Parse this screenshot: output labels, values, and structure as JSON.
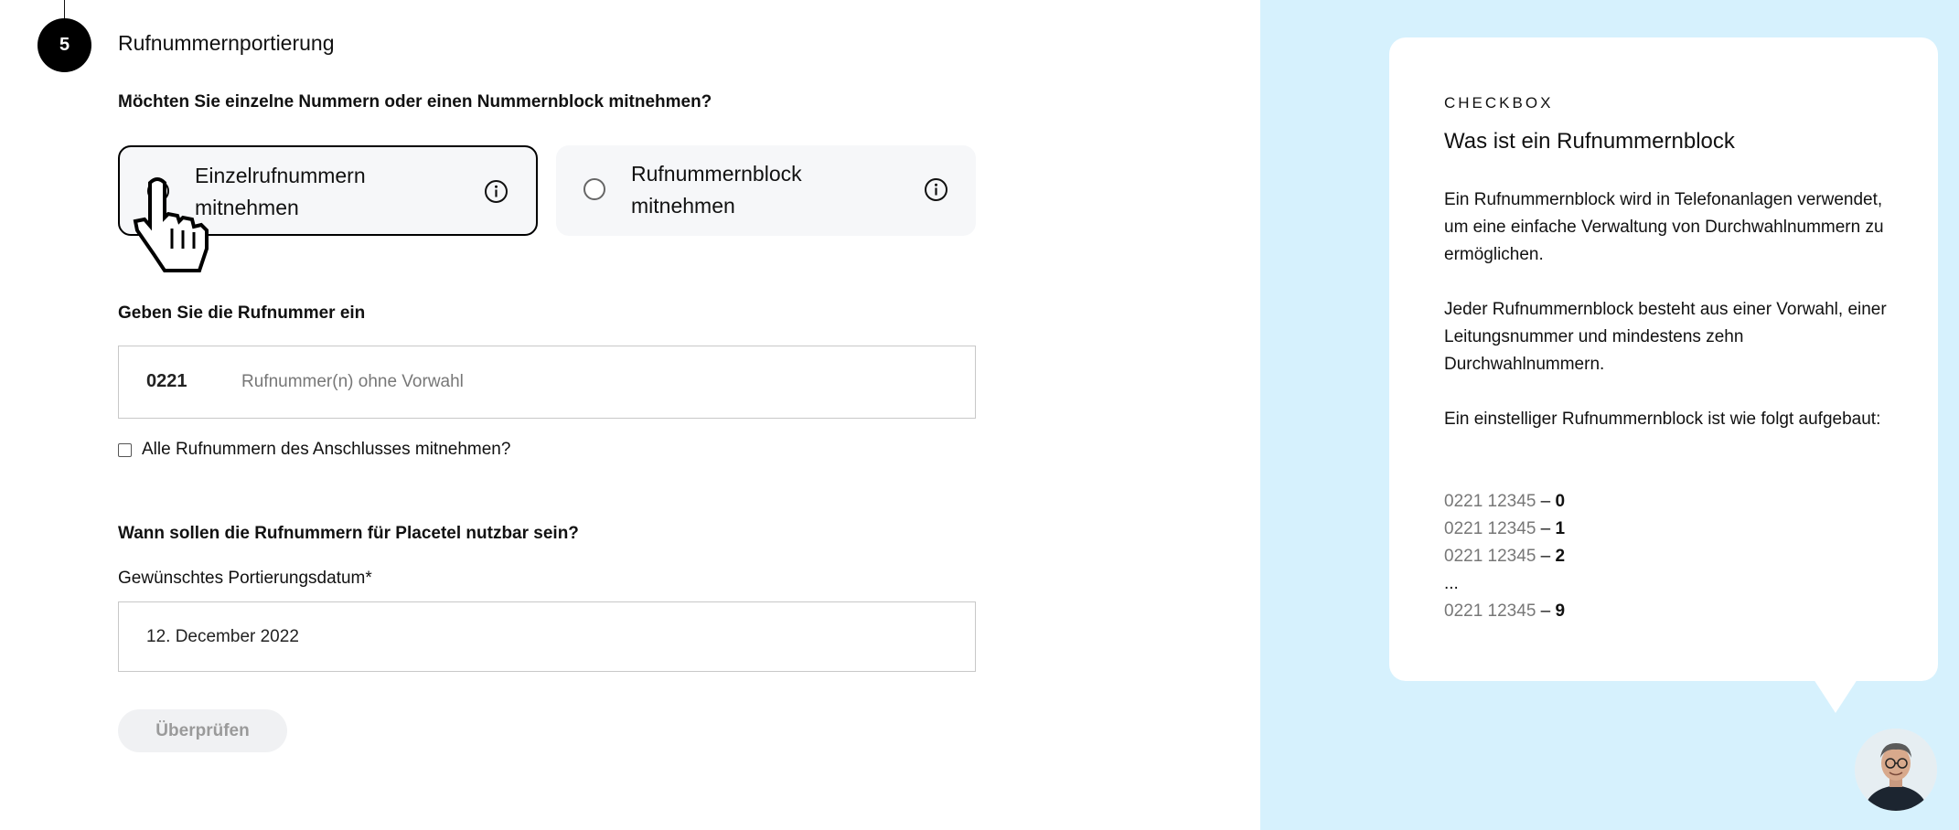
{
  "step": {
    "number": "5",
    "title": "Rufnummernportierung"
  },
  "question_numbers": "Möchten Sie einzelne Nummern oder einen Nummernblock mitnehmen?",
  "options": [
    {
      "label": "Einzelrufnummern mitnehmen",
      "selected": true,
      "info_icon": "info-icon"
    },
    {
      "label": "Rufnummernblock mitnehmen",
      "selected": false,
      "info_icon": "info-icon"
    }
  ],
  "phone": {
    "heading": "Geben Sie die Rufnummer ein",
    "prefix": "0221",
    "placeholder": "Rufnummer(n) ohne Vorwahl",
    "value": ""
  },
  "checkbox": {
    "label": "Alle Rufnummern des Anschlusses mitnehmen?",
    "checked": false
  },
  "date": {
    "heading": "Wann sollen die Rufnummern für Placetel nutzbar sein?",
    "label": "Gewünschtes Portierungsdatum",
    "required_mark": "*",
    "value": "12. December 2022"
  },
  "submit_button": "Überprüfen",
  "help": {
    "eyebrow": "CHECKBOX",
    "title": "Was ist ein Rufnummernblock",
    "p1": "Ein Rufnummernblock wird in Telefonanlagen verwendet, um eine einfache Verwaltung von Durchwahlnummern zu ermöglichen.",
    "p2": "Jeder Rufnummernblock besteht aus einer Vorwahl, einer Leitungsnummer und mindestens zehn Durchwahlnummern.",
    "p3": "Ein einstelliger Rufnummernblock ist wie folgt aufgebaut:",
    "examples": [
      {
        "base": "0221 12345",
        "dash": " – ",
        "ext": "0"
      },
      {
        "base": "0221 12345",
        "dash": " – ",
        "ext": "1"
      },
      {
        "base": "0221 12345",
        "dash": " – ",
        "ext": "2"
      },
      {
        "ellipsis": "..."
      },
      {
        "base": "0221 12345",
        "dash": " – ",
        "ext": "9"
      }
    ]
  },
  "colors": {
    "panel_bg": "#d6f1fd",
    "option_bg": "#f6f7f9",
    "button_bg": "#f0f1f3",
    "button_text": "#9a9a9a"
  }
}
